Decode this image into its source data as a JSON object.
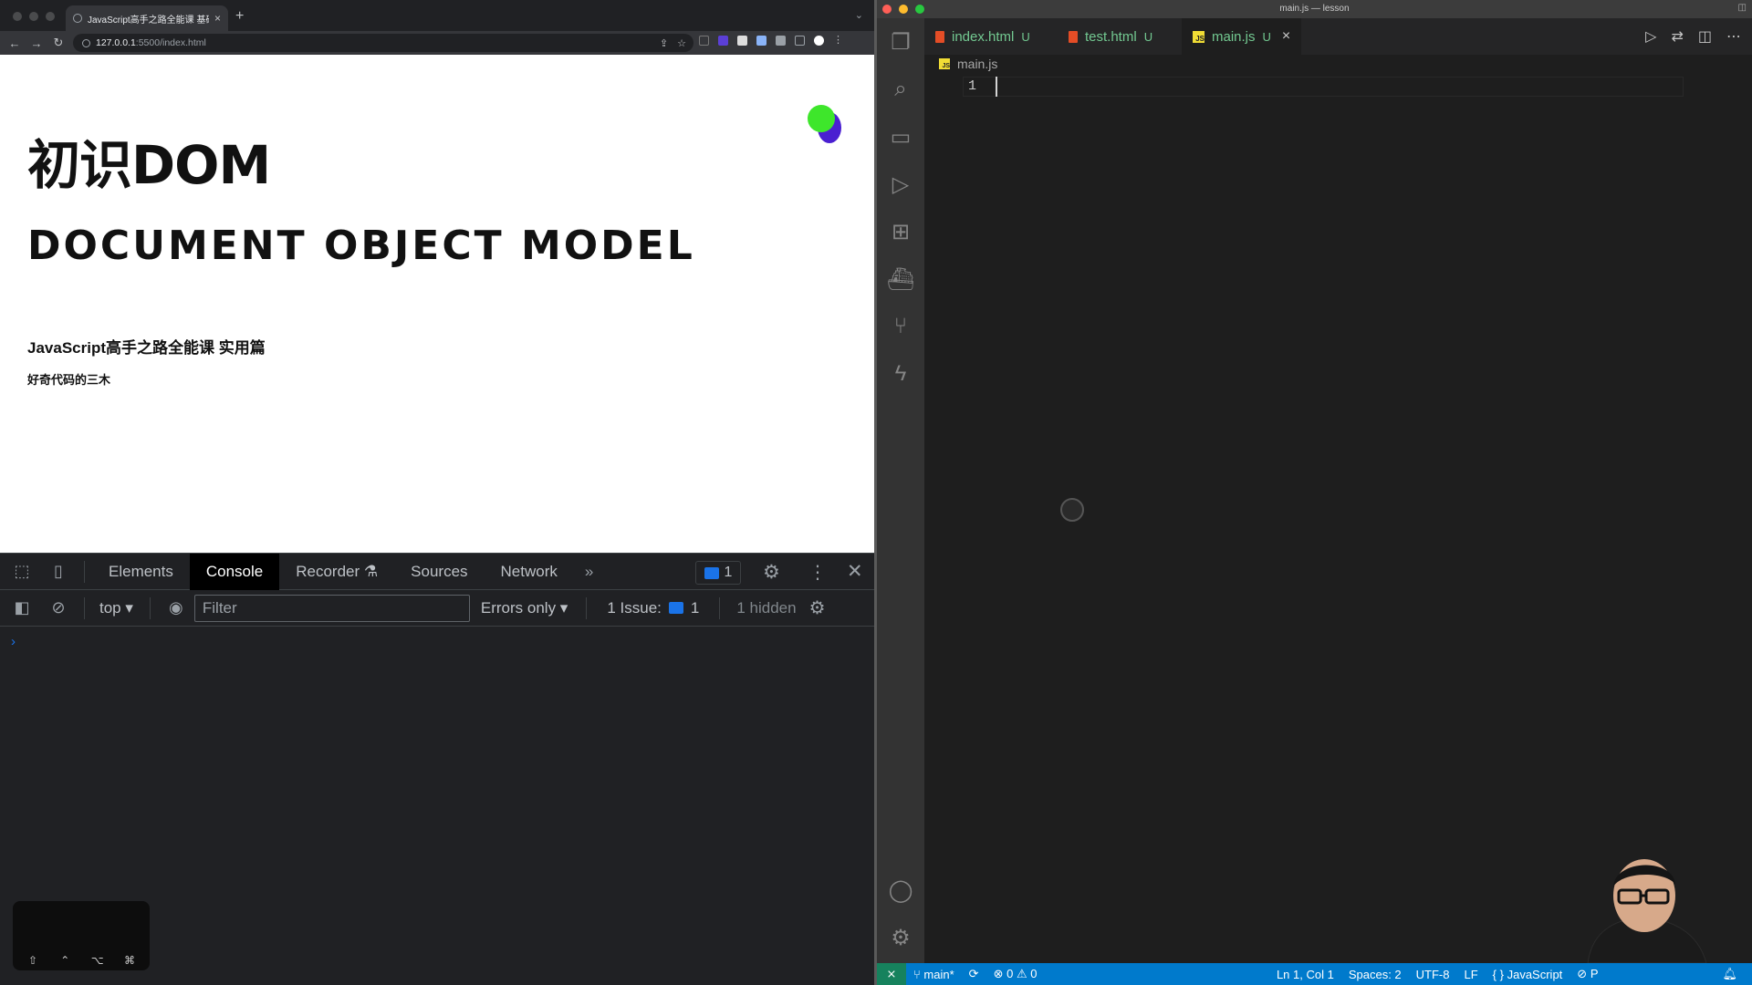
{
  "browser": {
    "tab_title": "JavaScript高手之路全能课 基础",
    "tab_close": "×",
    "new_tab": "+",
    "url_host": "127.0.0.1",
    "url_rest": ":5500/index.html",
    "nav": {
      "back": "←",
      "forward": "→",
      "reload": "↻"
    }
  },
  "page": {
    "title": "初识DOM",
    "subtitle": "DOCUMENT OBJECT MODEL",
    "course": "JavaScript高手之路全能课 实用篇",
    "author": "好奇代码的三木"
  },
  "devtools": {
    "tabs": [
      "Elements",
      "Console",
      "Recorder",
      "Sources",
      "Network"
    ],
    "active_tab": "Console",
    "more": "»",
    "message_count": "1",
    "context": "top ▾",
    "filter_placeholder": "Filter",
    "level": "Errors only ▾",
    "issues_label": "1 Issue:",
    "issues_count": "1",
    "hidden": "1 hidden",
    "prompt": "›",
    "accent": "#1a73e8"
  },
  "keyboard_overlay": {
    "keys": [
      "⇧",
      "⌃",
      "⌥",
      "⌘"
    ]
  },
  "vscode": {
    "window_title": "main.js — lesson",
    "tabs": [
      {
        "name": "index.html",
        "status": "U",
        "type": "html"
      },
      {
        "name": "test.html",
        "status": "U",
        "type": "html"
      },
      {
        "name": "main.js",
        "status": "U",
        "type": "js",
        "close": "×"
      }
    ],
    "active_tab": "main.js",
    "breadcrumb": "main.js",
    "js_badge": "JS",
    "line_number": "1",
    "status": {
      "branch": "main*",
      "errors": "0",
      "warnings": "0",
      "position": "Ln 1, Col 1",
      "spaces": "Spaces: 2",
      "encoding": "UTF-8",
      "eol": "LF",
      "language": "JavaScript",
      "prettier": "P",
      "bg": "#007acc"
    }
  }
}
